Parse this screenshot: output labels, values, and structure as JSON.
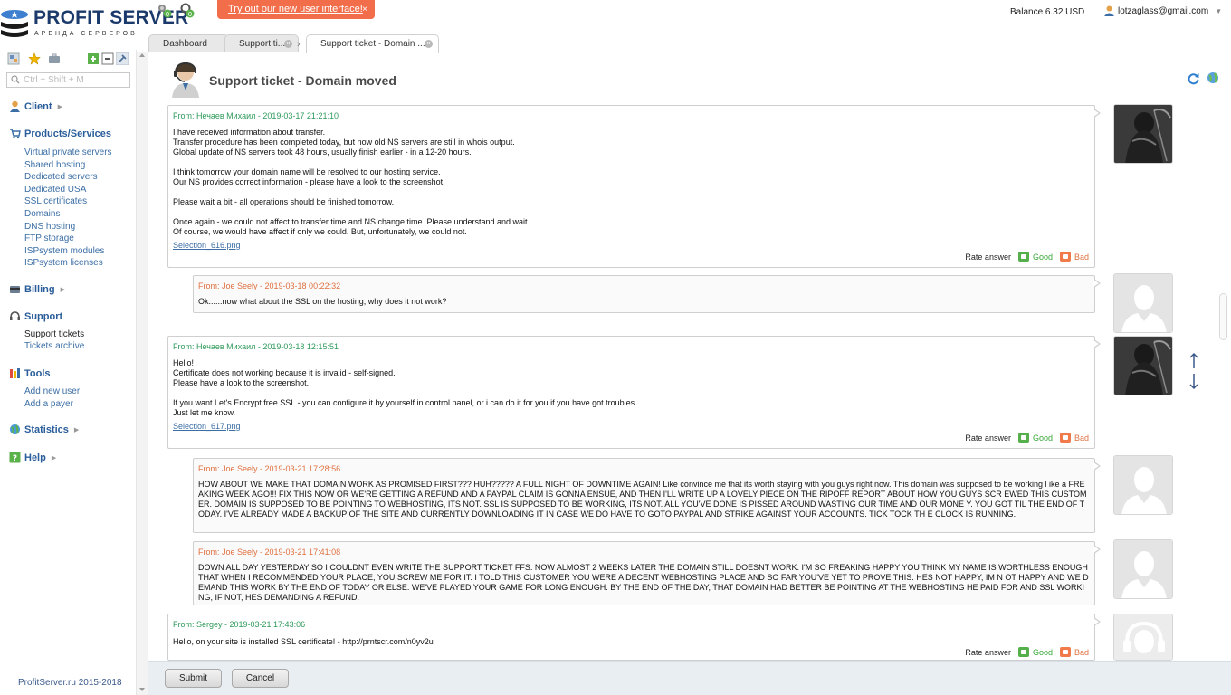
{
  "brand": {
    "name": "PROFIT SERVER",
    "tagline": "АРЕНДА СЕРВЕРОВ"
  },
  "promo": {
    "text": "Try out our new user interface!",
    "close": "×"
  },
  "account": {
    "balance": "Balance 6.32 USD",
    "email": "lotzaglass@gmail.com"
  },
  "tabs": [
    {
      "label": "Dashboard"
    },
    {
      "label": "Support ti..."
    },
    {
      "label": "Support ticket - Domain ..."
    }
  ],
  "tab_separator": "›",
  "search": {
    "placeholder": "Ctrl + Shift + M"
  },
  "sidebar": {
    "client": "Client",
    "products": "Products/Services",
    "products_items": [
      "Virtual private servers",
      "Shared hosting",
      "Dedicated servers",
      "Dedicated USA",
      "SSL certificates",
      "Domains",
      "DNS hosting",
      "FTP storage",
      "ISPsystem modules",
      "ISPsystem licenses"
    ],
    "billing": "Billing",
    "support": "Support",
    "support_items": [
      "Support tickets",
      "Tickets archive"
    ],
    "tools": "Tools",
    "tools_items": [
      "Add new user",
      "Add a payer"
    ],
    "statistics": "Statistics",
    "help": "Help",
    "copyright": "ProfitServer.ru 2015-2018"
  },
  "page": {
    "title": "Support ticket - Domain moved"
  },
  "rate": {
    "label": "Rate answer",
    "good": "Good",
    "bad": "Bad"
  },
  "messages": [
    {
      "from": "From: Нечаев Михаил - 2019-03-17 21:21:10",
      "lines": [
        "I have received information about transfer.",
        "Transfer procedure has been completed today, but now old NS servers are still in whois output.",
        "Global update of NS servers took 48 hours, usually finish earlier - in a 12-20 hours.",
        "",
        "I think tomorrow your domain name will be resolved to our hosting service.",
        "Our NS provides correct information - please have a look to the screenshot.",
        "",
        "Please wait a bit - all operations should be finished tomorrow.",
        "",
        "Once again - we could not affect to transfer time and NS change time. Please understand and wait.",
        "Of course, we would have affect if only we could. But, unfortunately, we could not."
      ],
      "attachment": "Selection_616.png"
    },
    {
      "from": "From: Joe Seely - 2019-03-18 00:22:32",
      "text": "Ok......now what about the SSL on the hosting, why does it not work?"
    },
    {
      "from": "From: Нечаев Михаил - 2019-03-18 12:15:51",
      "lines": [
        "Hello!",
        "Certificate does not working because it is invalid - self-signed.",
        "Please have a look to the screenshot.",
        "",
        "If you want Let's Encrypt free SSL - you can configure it by yourself in control panel, or i can do it for you if you have got troubles.",
        "Just let me know."
      ],
      "attachment": "Selection_617.png"
    },
    {
      "from": "From: Joe Seely - 2019-03-21 17:28:56",
      "text": "HOW ABOUT WE MAKE THAT DOMAIN WORK AS PROMISED FIRST??? HUH????? A FULL NIGHT OF DOWNTIME AGAIN! Like convince me that its worth staying with you guys right now. This domain was supposed to be working l ike a FREAKING WEEK AGO!!! FIX THIS NOW OR WE'RE GETTING A REFUND AND A PAYPAL CLAIM IS GONNA ENSUE, AND THEN I'LL WRITE UP A LOVELY PIECE ON THE RIPOFF REPORT ABOUT HOW YOU GUYS SCR EWED THIS CUSTOMER. DOMAIN IS SUPPOSED TO BE POINTING TO WEBHOSTING, ITS NOT. SSL IS SUPPOSED TO BE WORKING, ITS NOT. ALL YOU'VE DONE IS PISSED AROUND WASTING OUR TIME AND OUR MONE Y. YOU GOT TIL THE END OF TODAY. I'VE ALREADY MADE A BACKUP OF THE SITE AND CURRENTLY DOWNLOADING IT IN CASE WE DO HAVE TO GOTO PAYPAL AND STRIKE AGAINST YOUR ACCOUNTS. TICK TOCK TH E CLOCK IS RUNNING."
    },
    {
      "from": "From: Joe Seely - 2019-03-21 17:41:08",
      "text": "DOWN ALL DAY YESTERDAY SO I COULDNT EVEN WRITE THE SUPPORT TICKET FFS. NOW ALMOST 2 WEEKS LATER THE DOMAIN STILL DOESNT WORK. I'M SO FREAKING HAPPY YOU THINK MY NAME IS WORTHLESS ENOUGH THAT WHEN I RECOMMENDED YOUR PLACE, YOU SCREW ME FOR IT. I TOLD THIS CUSTOMER YOU WERE A DECENT WEBHOSTING PLACE AND SO FAR YOU'VE YET TO PROVE THIS. HES NOT HAPPY, IM N OT HAPPY AND WE DEMAND THIS WORK BY THE END OF TODAY OR ELSE. WE'VE PLAYED YOUR GAME FOR LONG ENOUGH. BY THE END OF THE DAY, THAT DOMAIN HAD BETTER BE POINTING AT THE WEBHOSTING HE PAID FOR AND SSL WORKING, IF NOT, HES DEMANDING A REFUND."
    },
    {
      "from": "From: Sergey - 2019-03-21 17:43:06",
      "text": "Hello, on your site is installed SSL certificate! - http://prntscr.com/n0yv2u"
    }
  ],
  "buttons": {
    "submit": "Submit",
    "cancel": "Cancel"
  },
  "colors": {
    "staff_from": "#2e9a5b",
    "client_from": "#e0703f",
    "promo_bg": "#f26e4b",
    "link": "#3b6ea5"
  }
}
